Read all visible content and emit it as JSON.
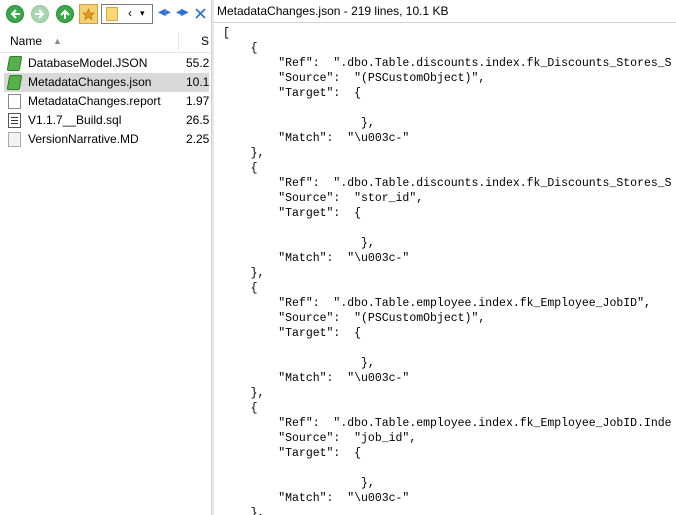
{
  "toolbar": {
    "back_icon": "back-arrow-icon",
    "forward_icon": "forward-arrow-icon",
    "up_icon": "up-arrow-icon",
    "favorites_icon": "star-folder-icon",
    "folder_combo_chevron": "‹",
    "folder_combo_dropdown": "▾",
    "left_arrow": "◀▸",
    "right_arrow": "◂▶"
  },
  "file_list": {
    "header_name": "Name",
    "header_size": "S",
    "files": [
      {
        "name": "DatabaseModel.JSON",
        "size": "55.2",
        "icon": "json-file-icon",
        "selected": false
      },
      {
        "name": "MetadataChanges.json",
        "size": "10.1",
        "icon": "json-file-icon",
        "selected": true
      },
      {
        "name": "MetadataChanges.report",
        "size": "1.97",
        "icon": "report-file-icon",
        "selected": false
      },
      {
        "name": "V1.1.7__Build.sql",
        "size": "26.5",
        "icon": "sql-file-icon",
        "selected": false
      },
      {
        "name": "VersionNarrative.MD",
        "size": "2.25",
        "icon": "md-file-icon",
        "selected": false
      }
    ]
  },
  "viewer": {
    "title": "MetadataChanges.json - 219 lines, 10.1 KB",
    "lines": [
      "[",
      "    {",
      "        \"Ref\":  \".dbo.Table.discounts.index.fk_Discounts_Stores_S",
      "        \"Source\":  \"(PSCustomObject)\",",
      "        \"Target\":  {",
      "",
      "                    },",
      "        \"Match\":  \"\\u003c-\"",
      "    },",
      "    {",
      "        \"Ref\":  \".dbo.Table.discounts.index.fk_Discounts_Stores_S",
      "        \"Source\":  \"stor_id\",",
      "        \"Target\":  {",
      "",
      "                    },",
      "        \"Match\":  \"\\u003c-\"",
      "    },",
      "    {",
      "        \"Ref\":  \".dbo.Table.employee.index.fk_Employee_JobID\",",
      "        \"Source\":  \"(PSCustomObject)\",",
      "        \"Target\":  {",
      "",
      "                    },",
      "        \"Match\":  \"\\u003c-\"",
      "    },",
      "    {",
      "        \"Ref\":  \".dbo.Table.employee.index.fk_Employee_JobID.Inde",
      "        \"Source\":  \"job_id\",",
      "        \"Target\":  {",
      "",
      "                    },",
      "        \"Match\":  \"\\u003c-\"",
      "    },"
    ]
  }
}
